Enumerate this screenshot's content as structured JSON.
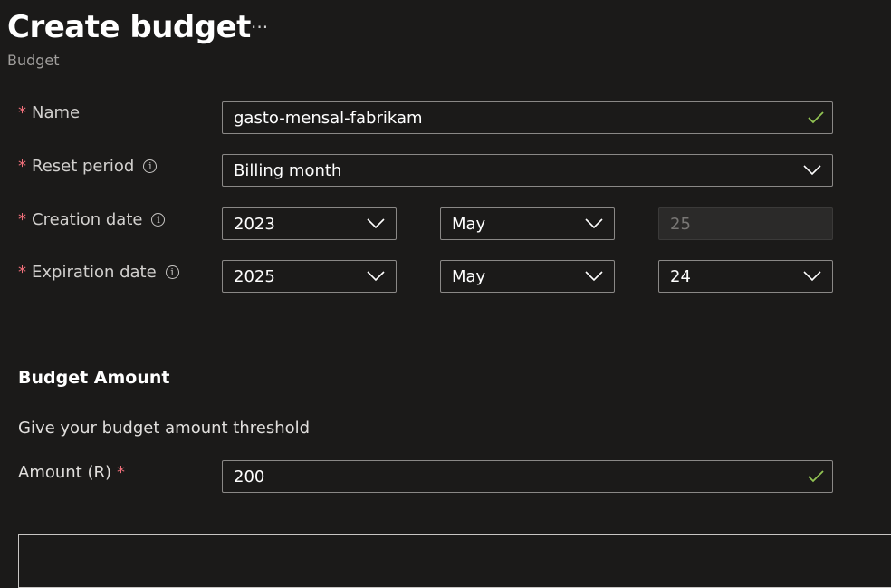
{
  "header": {
    "title": "Create budget",
    "more_label": "···",
    "subtitle": "Budget"
  },
  "form": {
    "name": {
      "label": "Name",
      "required_mark": "*",
      "value": "gasto-mensal-fabrikam",
      "valid_icon": "checkmark-icon"
    },
    "reset_period": {
      "label": "Reset period",
      "required_mark": "*",
      "info_icon": "i",
      "value": "Billing month"
    },
    "creation_date": {
      "label": "Creation date",
      "required_mark": "*",
      "info_icon": "i",
      "year": "2023",
      "month": "May",
      "day": "25"
    },
    "expiration_date": {
      "label": "Expiration date",
      "required_mark": "*",
      "info_icon": "i",
      "year": "2025",
      "month": "May",
      "day": "24"
    }
  },
  "budget_amount": {
    "title": "Budget Amount",
    "description": "Give your budget amount threshold",
    "amount_label": "Amount (R)",
    "required_mark": "*",
    "amount_value": "200",
    "valid_icon": "checkmark-icon"
  },
  "colors": {
    "background": "#1b1a19",
    "required": "#f1707b",
    "valid_check": "#92c353",
    "field_border": "#8a8886"
  }
}
